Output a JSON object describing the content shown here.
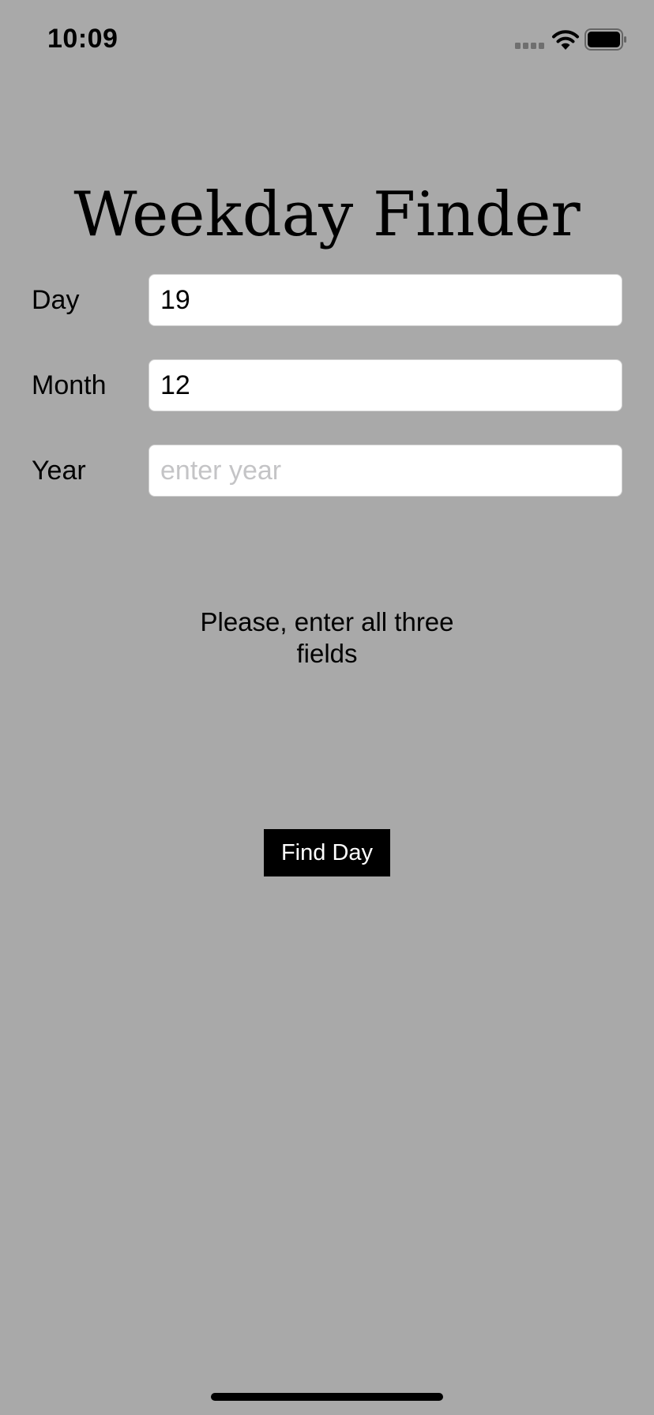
{
  "status_bar": {
    "time": "10:09",
    "icons": [
      "signal-icon",
      "wifi-icon",
      "battery-icon"
    ]
  },
  "app": {
    "title": "Weekday Finder"
  },
  "form": {
    "day": {
      "label": "Day",
      "value": "19",
      "placeholder": ""
    },
    "month": {
      "label": "Month",
      "value": "12",
      "placeholder": ""
    },
    "year": {
      "label": "Year",
      "value": "",
      "placeholder": "enter year"
    }
  },
  "message": "Please, enter all three fields",
  "button": {
    "label": "Find Day"
  },
  "colors": {
    "background": "#a9a9a9",
    "input_background": "#ffffff",
    "button_background": "#000000",
    "button_text": "#ffffff",
    "placeholder": "#c4c4c6"
  }
}
